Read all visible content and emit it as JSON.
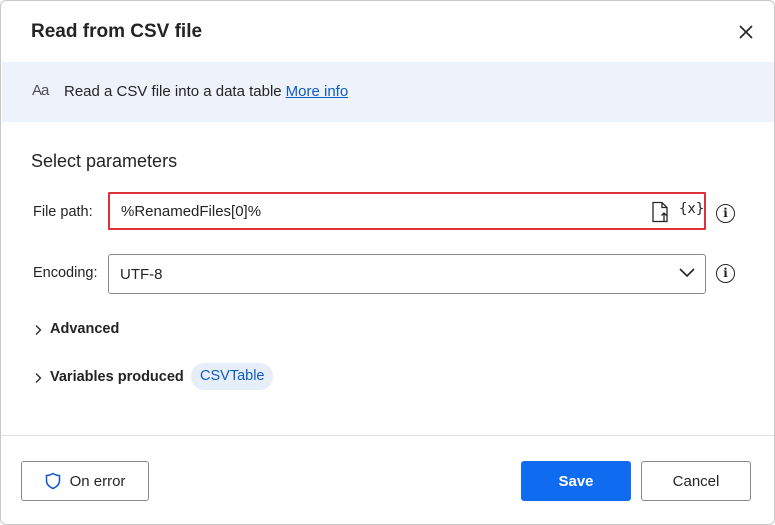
{
  "dialog": {
    "title": "Read from CSV file"
  },
  "banner": {
    "icon": "Aa",
    "icon_name": "text-format-icon",
    "text": "Read a CSV file into a data table",
    "link": "More info"
  },
  "parameters": {
    "section_title": "Select parameters",
    "file_path": {
      "label": "File path:",
      "value": "%RenamedFiles[0]%",
      "variable_icon": "{x}"
    },
    "encoding": {
      "label": "Encoding:",
      "value": "UTF-8"
    }
  },
  "expanders": {
    "advanced": "Advanced",
    "variables_produced": "Variables produced",
    "variable_pill": "CSVTable"
  },
  "footer": {
    "on_error": "On error",
    "save": "Save",
    "cancel": "Cancel"
  },
  "colors": {
    "accent": "#0f6cf0",
    "highlight_border": "#e0303a",
    "banner_bg": "#eef3fb",
    "link": "#0f5bbf"
  }
}
